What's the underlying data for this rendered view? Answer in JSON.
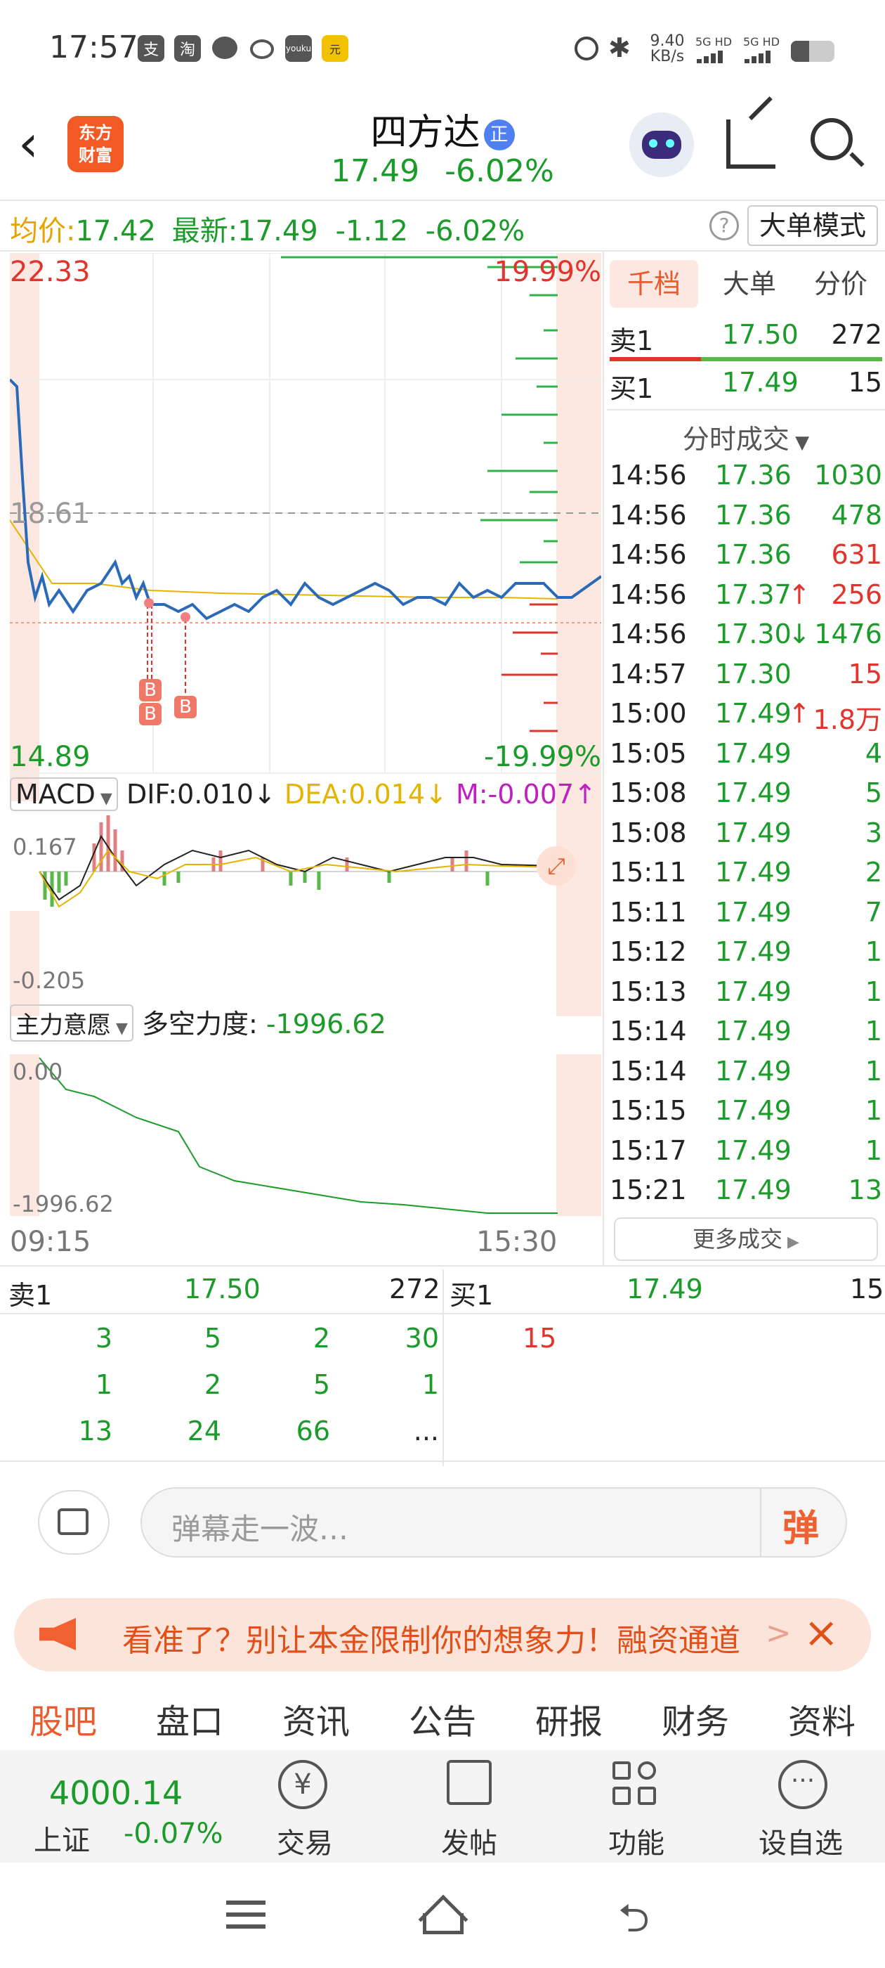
{
  "status": {
    "time": "17:57",
    "icons": [
      "alipay-icon",
      "taobao-icon",
      "chat-icon",
      "chat2-icon",
      "youku-icon",
      "app-icon"
    ],
    "speed": "9.40",
    "speed_unit": "KB/s",
    "network1": "5G HD",
    "network2": "5G HD"
  },
  "header": {
    "logo_line1": "东方",
    "logo_line2": "财富",
    "stock_name": "四方达",
    "badge": "正",
    "price": "17.49",
    "change_pct": "-6.02%"
  },
  "infobar": {
    "avg_label": "均价:",
    "avg_value": "17.42",
    "latest_label": "最新:",
    "latest_value": "17.49",
    "change": "-1.12",
    "change_pct": "-6.02%",
    "help": "?",
    "mode_button": "大单模式"
  },
  "chart": {
    "high": "22.33",
    "high_pct": "19.99%",
    "ref": "18.61",
    "low": "14.89",
    "low_pct": "-19.99%",
    "marker_b": "B",
    "macd_label": "MACD",
    "dif": "DIF:0.010",
    "dif_arrow": "↓",
    "dea": "DEA:0.014",
    "dea_arrow": "↓",
    "m": "M:-0.007",
    "m_arrow": "↑",
    "macd_top": "0.167",
    "macd_bottom": "-0.205",
    "zl_label": "主力意愿",
    "zl_title": "多空力度:",
    "zl_value": "-1996.62",
    "zl_top": "0.00",
    "zl_bottom": "-1996.62",
    "time_start": "09:15",
    "time_end": "15:30"
  },
  "side": {
    "tabs": [
      "千档",
      "大单",
      "分价"
    ],
    "sell1_label": "卖1",
    "sell1_price": "17.50",
    "sell1_vol": "272",
    "buy1_label": "买1",
    "buy1_price": "17.49",
    "buy1_vol": "15",
    "ticks_title": "分时成交",
    "ticks": [
      {
        "t": "14:56",
        "p": "17.36",
        "v": "1030",
        "vc": "green",
        "a": ""
      },
      {
        "t": "14:56",
        "p": "17.36",
        "v": "478",
        "vc": "green",
        "a": ""
      },
      {
        "t": "14:56",
        "p": "17.36",
        "v": "631",
        "vc": "red",
        "a": ""
      },
      {
        "t": "14:56",
        "p": "17.37",
        "v": "256",
        "vc": "red",
        "a": "↑"
      },
      {
        "t": "14:56",
        "p": "17.30",
        "v": "1476",
        "vc": "green",
        "a": "↓"
      },
      {
        "t": "14:57",
        "p": "17.30",
        "v": "15",
        "vc": "red",
        "a": ""
      },
      {
        "t": "15:00",
        "p": "17.49",
        "v": "1.8万",
        "vc": "red",
        "a": "↑"
      },
      {
        "t": "15:05",
        "p": "17.49",
        "v": "4",
        "vc": "green",
        "a": ""
      },
      {
        "t": "15:08",
        "p": "17.49",
        "v": "5",
        "vc": "green",
        "a": ""
      },
      {
        "t": "15:08",
        "p": "17.49",
        "v": "3",
        "vc": "green",
        "a": ""
      },
      {
        "t": "15:11",
        "p": "17.49",
        "v": "2",
        "vc": "green",
        "a": ""
      },
      {
        "t": "15:11",
        "p": "17.49",
        "v": "7",
        "vc": "green",
        "a": ""
      },
      {
        "t": "15:12",
        "p": "17.49",
        "v": "1",
        "vc": "green",
        "a": ""
      },
      {
        "t": "15:13",
        "p": "17.49",
        "v": "1",
        "vc": "green",
        "a": ""
      },
      {
        "t": "15:14",
        "p": "17.49",
        "v": "1",
        "vc": "green",
        "a": ""
      },
      {
        "t": "15:14",
        "p": "17.49",
        "v": "1",
        "vc": "green",
        "a": ""
      },
      {
        "t": "15:15",
        "p": "17.49",
        "v": "1",
        "vc": "green",
        "a": ""
      },
      {
        "t": "15:17",
        "p": "17.49",
        "v": "1",
        "vc": "green",
        "a": ""
      },
      {
        "t": "15:21",
        "p": "17.49",
        "v": "13",
        "vc": "green",
        "a": ""
      }
    ],
    "more_button": "更多成交"
  },
  "orderbook": {
    "sell_label": "卖1",
    "sell_price": "17.50",
    "sell_vol": "272",
    "buy_label": "买1",
    "buy_price": "17.49",
    "buy_vol": "15",
    "sell_rows": [
      [
        "3",
        "5",
        "2",
        "30"
      ],
      [
        "1",
        "2",
        "5",
        "1"
      ],
      [
        "13",
        "24",
        "66",
        "..."
      ]
    ],
    "buy_rows": [
      [
        "15"
      ]
    ]
  },
  "comment": {
    "placeholder": "弹幕走一波…",
    "danmu_button": "弹"
  },
  "banner": {
    "text": "看准了？别让本金限制你的想象力！融资通道",
    "arrow": ">"
  },
  "tabs": [
    "股吧",
    "盘口",
    "资讯",
    "公告",
    "研报",
    "财务",
    "资料"
  ],
  "bottom": {
    "index_value": "4000.14",
    "index_name": "上证",
    "index_change": "-0.07%",
    "trade": "交易",
    "post": "发帖",
    "func": "功能",
    "watch": "设自选"
  }
}
